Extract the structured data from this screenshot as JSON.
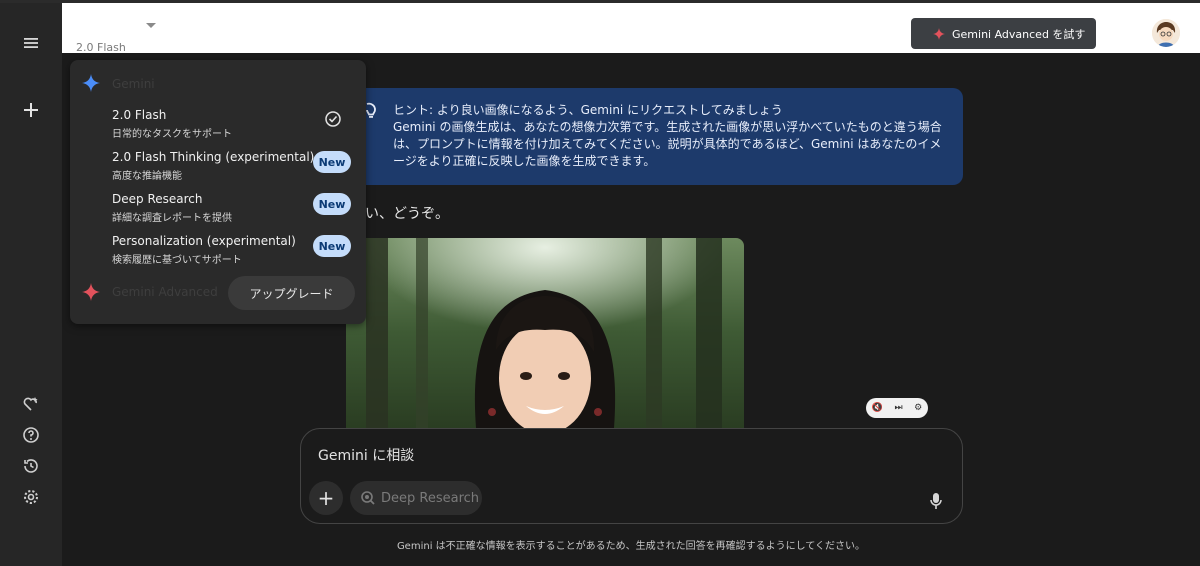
{
  "header": {
    "model_name": "2.0 Flash",
    "advanced_button": "Gemini Advanced を試す"
  },
  "model_menu": {
    "section_label": "Gemini",
    "items": [
      {
        "title": "2.0 Flash",
        "subtitle": "日常的なタスクをサポート",
        "selected": true
      },
      {
        "title": "2.0 Flash Thinking (experimental)",
        "subtitle": "高度な推論機能",
        "badge": "New"
      },
      {
        "title": "Deep Research",
        "subtitle": "詳細な調査レポートを提供",
        "badge": "New"
      },
      {
        "title": "Personalization (experimental)",
        "subtitle": "検索履歴に基づいてサポート",
        "badge": "New"
      }
    ],
    "advanced_label": "Gemini Advanced",
    "upgrade_button": "アップグレード"
  },
  "hint": {
    "title": "ヒント: より良い画像になるよう、Gemini にリクエストしてみましょう",
    "body": "Gemini の画像生成は、あなたの想像力次第です。生成された画像が思い浮かべていたものと違う場合は、プロンプトに情報を付け加えてみてください。説明が具体的であるほど、Gemini はあなたのイメージをより正確に反映した画像を生成できます。"
  },
  "reply": {
    "text": "い、どうぞ。"
  },
  "input": {
    "placeholder": "Gemini に相談",
    "deep_research_chip": "Deep Research"
  },
  "footer": {
    "disclaimer": "Gemini は不正確な情報を表示することがあるため、生成された回答を再確認するようにしてください。"
  },
  "colors": {
    "hint_bg": "#1d3a6b",
    "badge_bg": "#c4dcfa",
    "gemini_blue": "#4b8df8",
    "gemini_red": "#e2525c"
  }
}
